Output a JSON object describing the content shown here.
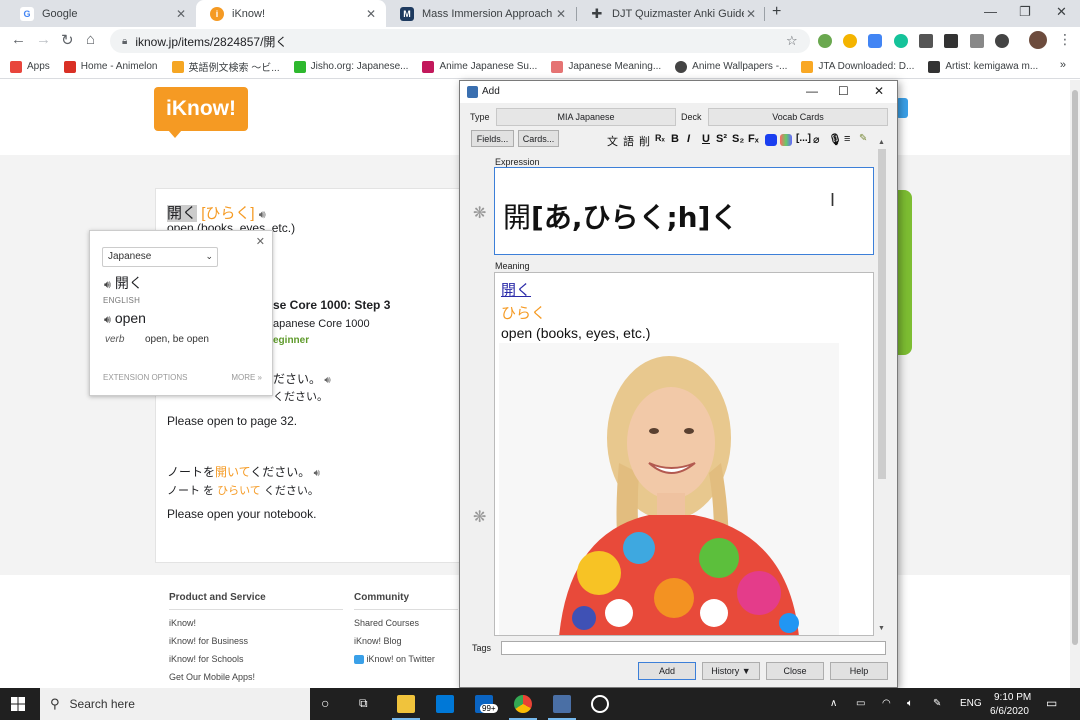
{
  "tabs": [
    {
      "title": "Google",
      "color": "#4285f4",
      "glyph": "G",
      "active": false
    },
    {
      "title": "iKnow!",
      "color": "#f59a23",
      "glyph": "i",
      "active": true
    },
    {
      "title": "Mass Immersion Approach",
      "color": "#1e3a5f",
      "glyph": "M",
      "active": false
    },
    {
      "title": "DJT Quizmaster Anki Guide",
      "color": "#ffffff",
      "glyph": "+",
      "active": false
    }
  ],
  "url": "iknow.jp/items/2824857/開く",
  "bookmarks": [
    {
      "label": "Apps",
      "color": "#e8453c"
    },
    {
      "label": "Home - Animelon",
      "color": "#d93025"
    },
    {
      "label": "英語例文検索 〜ビ...",
      "color": "#f5a623"
    },
    {
      "label": "Jisho.org: Japanese...",
      "color": "#2eb82e"
    },
    {
      "label": "Anime Japanese Su...",
      "color": "#c2185b"
    },
    {
      "label": "Japanese Meaning...",
      "color": "#e57373"
    },
    {
      "label": "Anime Wallpapers -...",
      "color": "#444444"
    },
    {
      "label": "JTA Downloaded: D...",
      "color": "#f9a825"
    },
    {
      "label": "Artist: kemigawa m...",
      "color": "#333333"
    }
  ],
  "iknow": {
    "logo": "iKnow!",
    "word_kanji": "開く",
    "word_kana": "[ひらく]",
    "word_meaning": "open (books, eyes, etc.)",
    "core_title": "se Core 1000: Step 3",
    "core_sub": "apanese Core 1000",
    "core_level": "eginner",
    "s1_jp_tail": "ださい。",
    "s1_reading_tail": "ください。",
    "s1_en": "Please open to page 32.",
    "s2_jp_a": "ノートを",
    "s2_jp_b": "開いて",
    "s2_jp_c": "ください。",
    "s2_rd_a": "ノート を",
    "s2_rd_b": "ひらいて",
    "s2_rd_c": "ください。",
    "s2_en": "Please open your notebook.",
    "footer": {
      "col1_title": "Product and Service",
      "col1": [
        "iKnow!",
        "iKnow! for Business",
        "iKnow! for Schools",
        "Get Our Mobile Apps!"
      ],
      "col2_title": "Community",
      "col2": [
        "Shared Courses",
        "iKnow! Blog",
        "iKnow! on Twitter"
      ]
    }
  },
  "popup": {
    "language": "Japanese",
    "term": "開く",
    "section": "ENGLISH",
    "translation": "open",
    "pos": "verb",
    "definition": "open, be open",
    "options": "EXTENSION OPTIONS",
    "more": "MORE »"
  },
  "anki": {
    "title": "Add",
    "type_label": "Type",
    "type_value": "MIA Japanese",
    "deck_label": "Deck",
    "deck_value": "Vocab Cards",
    "fields_btn": "Fields...",
    "cards_btn": "Cards...",
    "expression_label": "Expression",
    "expression_kanji": "開",
    "expression_rest": "[あ,ひらく;h]く",
    "meaning_label": "Meaning",
    "meaning_kanji": "開く",
    "meaning_kana": "ひらく",
    "meaning_en": "open (books, eyes, etc.)",
    "tags_label": "Tags",
    "add_btn": "Add",
    "history_btn": "History ▼",
    "close_btn": "Close",
    "help_btn": "Help"
  },
  "taskbar": {
    "search": "Search here",
    "badge": "99+",
    "lang": "ENG",
    "time": "9:10 PM",
    "date": "6/6/2020"
  }
}
